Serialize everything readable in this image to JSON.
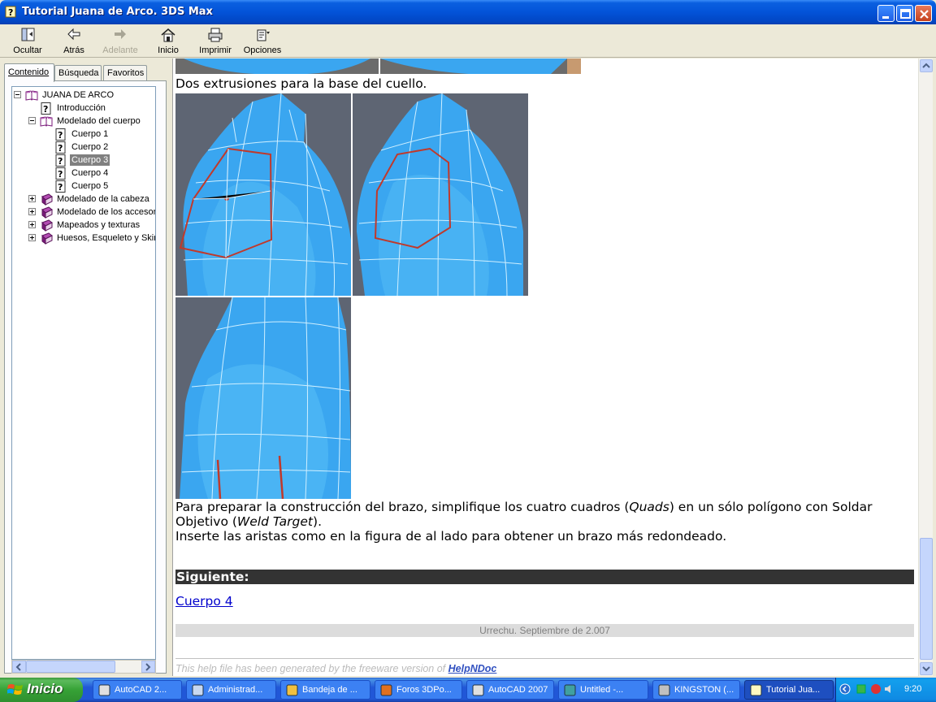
{
  "window": {
    "title": "Tutorial Juana de Arco. 3DS Max"
  },
  "toolbar": {
    "buttons": [
      {
        "label": "Ocultar",
        "icon": "hide-pane-icon",
        "enabled": true
      },
      {
        "label": "Atrás",
        "icon": "back-arrow-icon",
        "enabled": true
      },
      {
        "label": "Adelante",
        "icon": "forward-arrow-icon",
        "enabled": false
      },
      {
        "label": "Inicio",
        "icon": "home-icon",
        "enabled": true
      },
      {
        "label": "Imprimir",
        "icon": "print-icon",
        "enabled": true
      },
      {
        "label": "Opciones",
        "icon": "options-icon",
        "enabled": true
      }
    ]
  },
  "tabs": [
    {
      "label": "Contenido",
      "active": true
    },
    {
      "label": "Búsqueda",
      "active": false
    },
    {
      "label": "Favoritos",
      "active": false
    }
  ],
  "tree": [
    {
      "label": "JUANA DE ARCO",
      "icon": "open-book-icon",
      "expanded": true,
      "selected": false
    },
    {
      "label": "Introducción",
      "icon": "help-page-icon",
      "selected": false
    },
    {
      "label": "Modelado del cuerpo",
      "icon": "open-book-icon",
      "expanded": true,
      "selected": false
    },
    {
      "label": "Cuerpo 1",
      "icon": "help-page-icon",
      "selected": false
    },
    {
      "label": "Cuerpo 2",
      "icon": "help-page-icon",
      "selected": false
    },
    {
      "label": "Cuerpo 3",
      "icon": "help-page-icon",
      "selected": true
    },
    {
      "label": "Cuerpo 4",
      "icon": "help-page-icon",
      "selected": false
    },
    {
      "label": "Cuerpo 5",
      "icon": "help-page-icon",
      "selected": false
    },
    {
      "label": "Modelado de la cabeza",
      "icon": "closed-book-icon",
      "expanded": false,
      "selected": false
    },
    {
      "label": "Modelado de los accesorios",
      "icon": "closed-book-icon",
      "expanded": false,
      "selected": false
    },
    {
      "label": "Mapeados y texturas",
      "icon": "closed-book-icon",
      "expanded": false,
      "selected": false
    },
    {
      "label": "Huesos, Esqueleto y Skin",
      "icon": "closed-book-icon",
      "expanded": false,
      "selected": false
    }
  ],
  "content": {
    "caption1": "Dos extrusiones para la base del cuello.",
    "para1_a": "Para preparar la construcción del brazo, simplifique los cuatro cuadros (",
    "para1_quads": "Quads",
    "para1_b": ") en un sólo polígono con Soldar",
    "para1_c": "Objetivo (",
    "para1_weld": "Weld Target",
    "para1_d": ").",
    "para2": "Inserte las aristas como en la figura de al lado para obtener un brazo más redondeado.",
    "next_heading": "Siguiente:",
    "next_link": "Cuerpo 4",
    "footer": "Urrechu. Septiembre de 2.007",
    "generated_text": "This help file has been generated by the freeware version of ",
    "generated_link": "HelpNDoc"
  },
  "taskbar": {
    "start_label": "Inicio",
    "tasks": [
      {
        "label": "AutoCAD 2...",
        "icon": "autocad-icon",
        "active": false
      },
      {
        "label": "Administrad...",
        "icon": "window-icon",
        "active": false
      },
      {
        "label": "Bandeja de ...",
        "icon": "mail-icon",
        "active": false
      },
      {
        "label": "Foros 3DPo...",
        "icon": "firefox-icon",
        "active": false
      },
      {
        "label": "AutoCAD 2007",
        "icon": "autocad-icon",
        "active": false
      },
      {
        "label": "Untitled    -...",
        "icon": "3dsmax-icon",
        "active": false
      },
      {
        "label": "KINGSTON (...",
        "icon": "drive-icon",
        "active": false
      },
      {
        "label": "Tutorial Jua...",
        "icon": "help-file-icon",
        "active": true
      }
    ],
    "clock": "9:20"
  },
  "colors": {
    "mesh_blue": "#3aa6f0",
    "edge_red": "#c0392b",
    "selected_node_bg": "#808080",
    "link_blue": "#0000cc"
  }
}
